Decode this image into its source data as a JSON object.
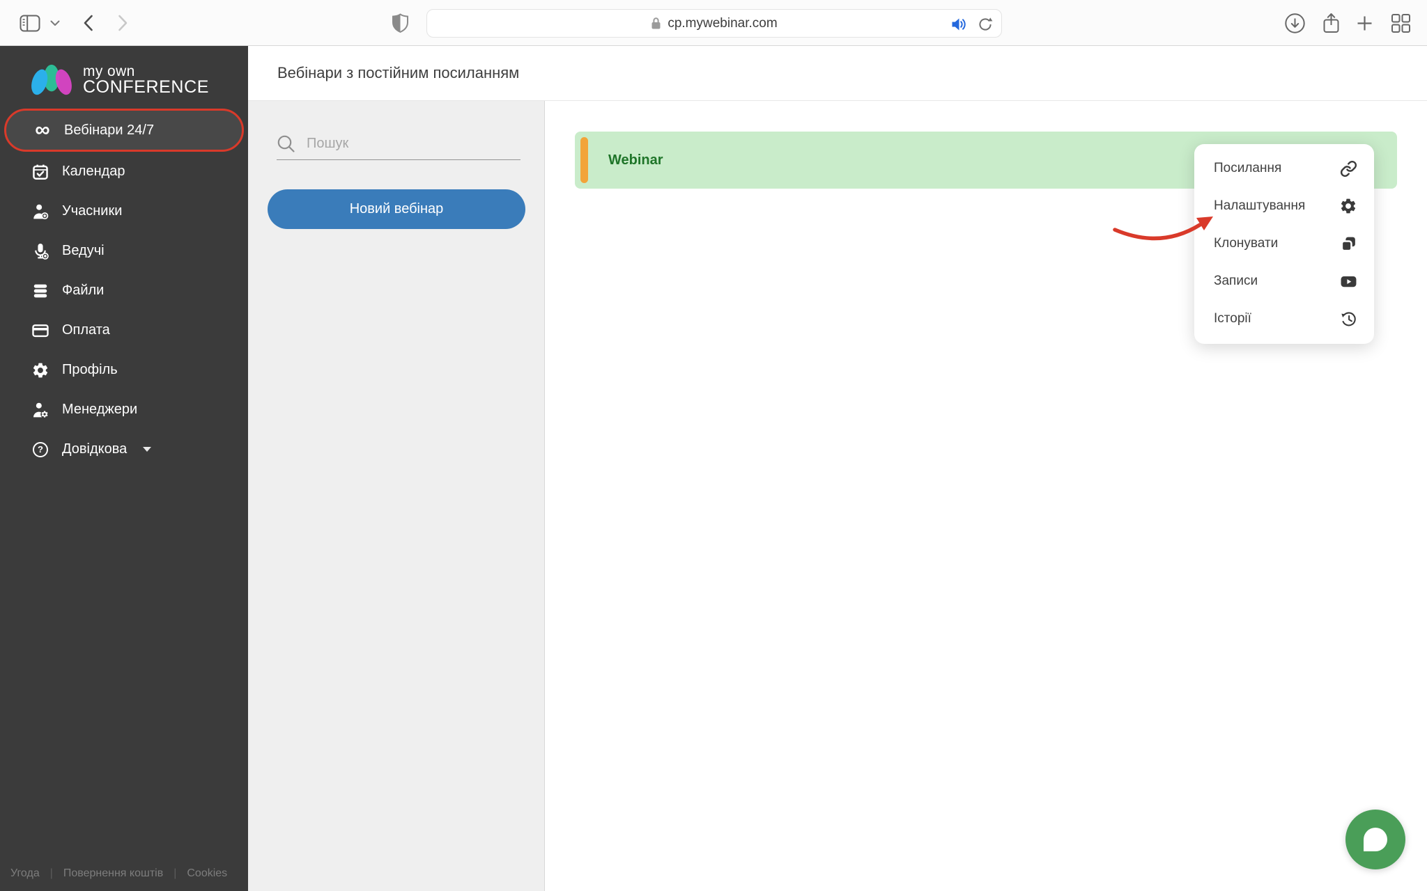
{
  "browser": {
    "url": "cp.mywebinar.com"
  },
  "sidebar": {
    "logo": {
      "line1": "my own",
      "line2": "CONFERENCE"
    },
    "items": [
      {
        "label": "Вебінари 24/7",
        "active": true
      },
      {
        "label": "Календар",
        "active": false
      },
      {
        "label": "Учасники",
        "active": false
      },
      {
        "label": "Ведучі",
        "active": false
      },
      {
        "label": "Файли",
        "active": false
      },
      {
        "label": "Оплата",
        "active": false
      },
      {
        "label": "Профіль",
        "active": false
      },
      {
        "label": "Менеджери",
        "active": false
      },
      {
        "label": "Довідкова",
        "active": false
      }
    ],
    "footer": {
      "links": [
        "Угода",
        "Повернення коштів",
        "Cookies"
      ],
      "separator": "|"
    }
  },
  "header": {
    "title": "Вебінари з постійним посиланням"
  },
  "panel": {
    "search_placeholder": "Пошук",
    "new_webinar": "Новий вебінар"
  },
  "webinars": [
    {
      "title": "Webinar",
      "status_color": "#f2a43a",
      "row_bg": "#c9ecca"
    }
  ],
  "context_menu": {
    "items": [
      {
        "label": "Посилання",
        "icon": "link-icon"
      },
      {
        "label": "Налаштування",
        "icon": "gear-icon"
      },
      {
        "label": "Клонувати",
        "icon": "clone-icon"
      },
      {
        "label": "Записи",
        "icon": "youtube-icon"
      },
      {
        "label": "Історії",
        "icon": "history-icon"
      }
    ]
  },
  "icons": {
    "infinity_glyph": "∞",
    "question_glyph": "?"
  },
  "colors": {
    "accent_blue": "#3a7cba",
    "annotation_red": "#d93a2a",
    "row_green_bg": "#c9ecca",
    "row_green_text": "#1f7529",
    "status_orange": "#f2a43a",
    "chat_green": "#4a9e58",
    "sidebar_bg": "#3b3b3b"
  }
}
